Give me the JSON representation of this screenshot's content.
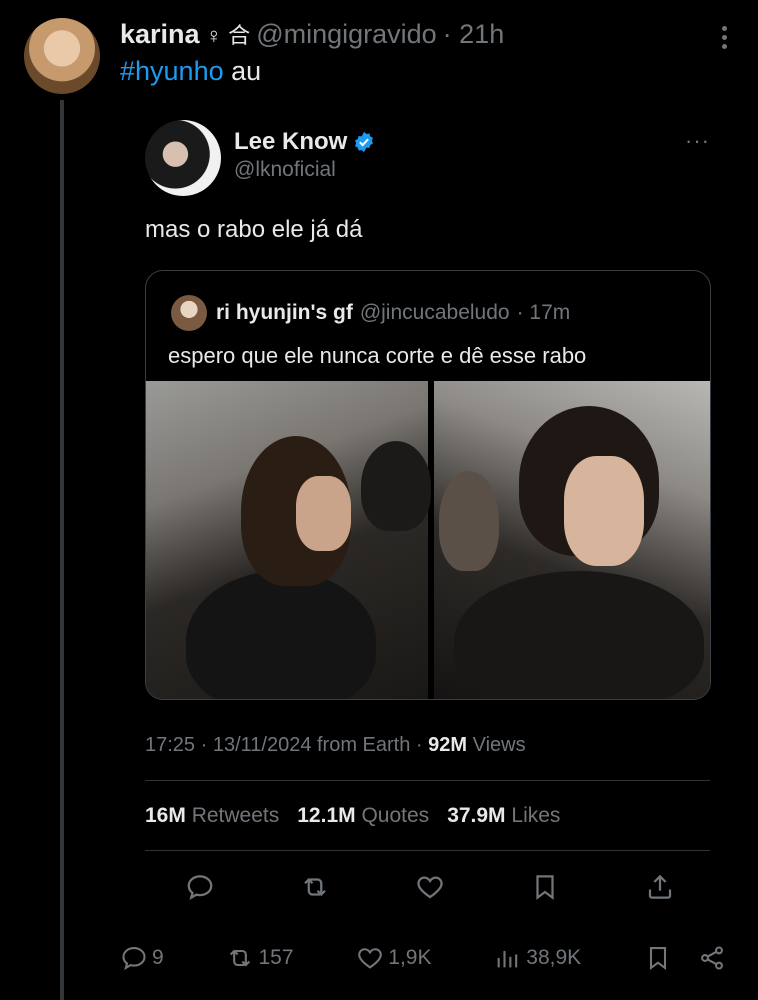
{
  "outer_tweet": {
    "author_name": "karina",
    "author_badges": "♀ 合",
    "handle": "@mingigravido",
    "time": "· 21h",
    "hashtag": "#hyunho",
    "text_rest": " au"
  },
  "quoted_tweet": {
    "author_name": "Lee Know",
    "handle": "@lknoficial",
    "more": "···",
    "text": "mas o rabo ele já dá"
  },
  "nested_quote": {
    "author_name": "ri hyunjin's gf",
    "handle": "@jincucabeludo",
    "time": "· 17m",
    "text": "espero que ele nunca corte e dê esse rabo"
  },
  "meta": {
    "timestamp": "17:25 · 13/11/2024 from Earth ·",
    "views_count": "92M",
    "views_label": "Views"
  },
  "stats": {
    "retweets_count": "16M",
    "retweets_label": "Retweets",
    "quotes_count": "12.1M",
    "quotes_label": "Quotes",
    "likes_count": "37.9M",
    "likes_label": "Likes"
  },
  "outer_actions": {
    "replies": "9",
    "retweets": "157",
    "likes": "1,9K",
    "views": "38,9K"
  },
  "colors": {
    "background": "#000000",
    "text": "#e7e9ea",
    "muted": "#71767b",
    "accent": "#1d9bf0"
  }
}
